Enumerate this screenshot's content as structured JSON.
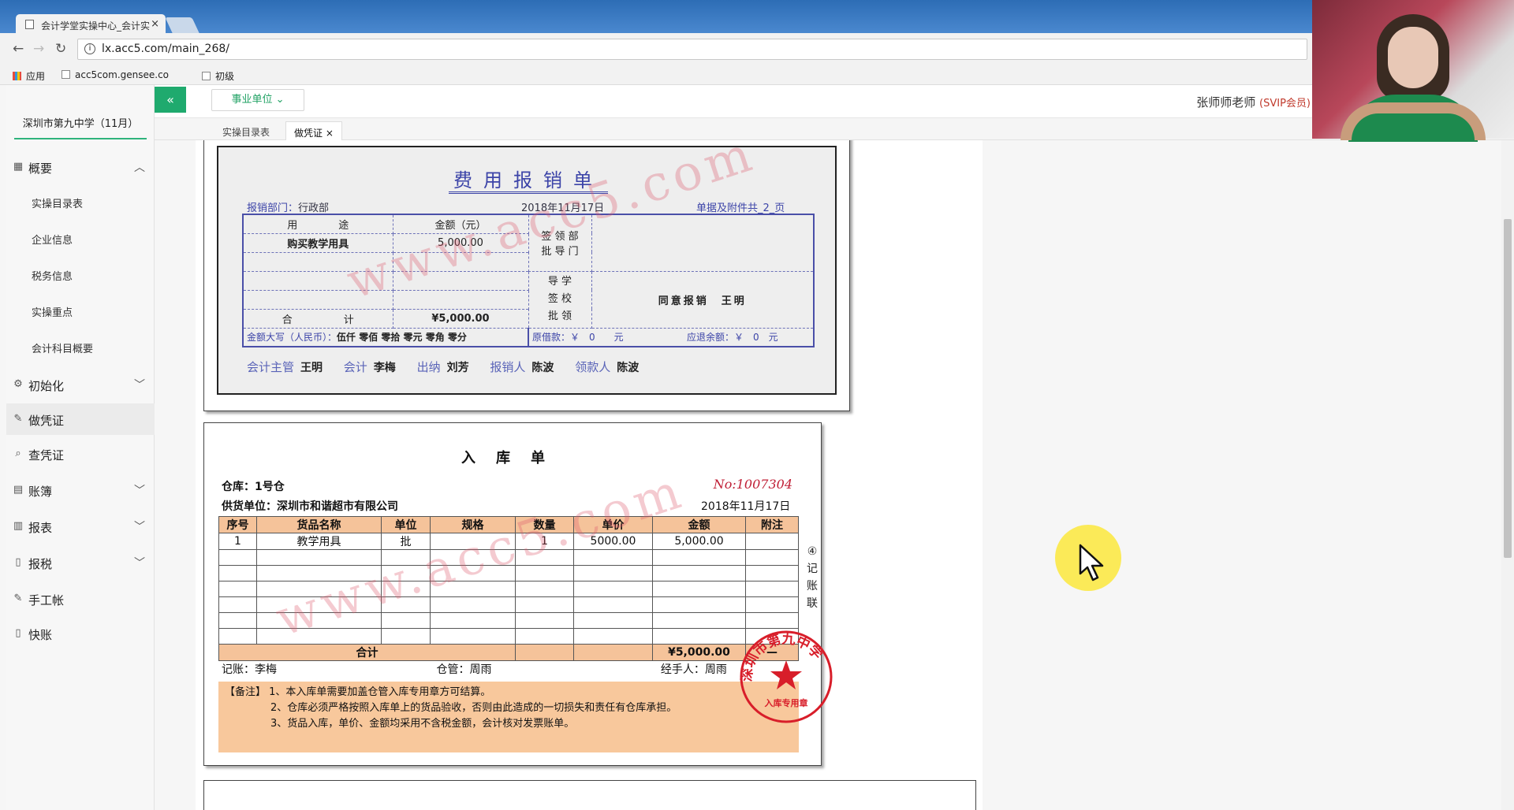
{
  "browser": {
    "tab_title": "会计学堂实操中心_会计实",
    "close": "×",
    "url": "lx.acc5.com/main_268/",
    "bookmarks": [
      "应用",
      "acc5com.gensee.co",
      "初级"
    ]
  },
  "sidebar": {
    "company": "深圳市第九中学（11月）",
    "sections": [
      {
        "label": "概要",
        "icon": "grid-icon",
        "expanded": true
      },
      {
        "label": "初始化",
        "icon": "gear-icon"
      },
      {
        "label": "做凭证",
        "icon": "pencil-icon",
        "active": true
      },
      {
        "label": "查凭证",
        "icon": "search-icon"
      },
      {
        "label": "账簿",
        "icon": "book-icon"
      },
      {
        "label": "报表",
        "icon": "report-icon"
      },
      {
        "label": "报税",
        "icon": "document-icon"
      },
      {
        "label": "手工帐",
        "icon": "pencil-icon"
      },
      {
        "label": "快账",
        "icon": "document-icon"
      }
    ],
    "sub_items": [
      "实操目录表",
      "企业信息",
      "税务信息",
      "实操重点",
      "会计科目概要"
    ]
  },
  "topbar": {
    "toggle": "«",
    "unit_select": "事业单位",
    "teacher": "张师师老师",
    "membership": "(SVIP会员)"
  },
  "page_tabs": [
    {
      "label": "实操目录表"
    },
    {
      "label": "做凭证",
      "close": "×",
      "active": true
    }
  ],
  "expense_form": {
    "title": "费用报销单",
    "dept_label": "报销部门：",
    "dept": "行政部",
    "date": "2018年11月17日",
    "attachments": "单据及附件共_2_页",
    "col_purpose": "用　　　　途",
    "col_amount": "金额（元）",
    "dept_sign": [
      "签 领 部",
      "批 导 门"
    ],
    "school_sign": [
      "导 学",
      "签 校",
      "批 领"
    ],
    "approve_text": "同意报销　王明",
    "item": "购买教学用具",
    "item_amount": "5,000.00",
    "total_label": "合　　　　　计",
    "total": "¥5,000.00",
    "capital_label": "金额大写（人民币）：",
    "capital": "伍仟 零佰 零拾 零元 零角 零分",
    "loan": "原借款：￥　0　　元",
    "refund": "应退余额：￥　0　元",
    "signatures": [
      {
        "role": "会计主管",
        "name": "王明"
      },
      {
        "role": "会计",
        "name": "李梅"
      },
      {
        "role": "出纳",
        "name": "刘芳"
      },
      {
        "role": "报销人",
        "name": "陈波"
      },
      {
        "role": "领款人",
        "name": "陈波"
      }
    ]
  },
  "receipt_form": {
    "title": "入库单",
    "warehouse": "仓库：1号仓",
    "supplier": "供货单位：深圳市和谐超市有限公司",
    "number": "No:1007304",
    "date": "2018年11月17日",
    "headers": [
      "序号",
      "货品名称",
      "单位",
      "规格",
      "数量",
      "单价",
      "金额",
      "附注"
    ],
    "rows": [
      [
        "1",
        "教学用具",
        "批",
        "",
        "1",
        "5000.00",
        "5,000.00",
        ""
      ]
    ],
    "empty_rows": 6,
    "total_label": "合计",
    "total_amount": "¥5,000.00",
    "total_note": "—",
    "side_label": [
      "④",
      "记",
      "账",
      "联"
    ],
    "bookkeeper": "记账：李梅",
    "keeper": "仓管：周雨",
    "handler": "经手人：周雨",
    "notes": [
      "【备注】 1、本入库单需要加盖仓管入库专用章方可结算。",
      "2、仓库必须严格按照入库单上的货品验收，否则由此造成的一切损失和责任有仓库承担。",
      "3、货品入库，单价、金额均采用不含税金额，会计核对发票账单。"
    ]
  },
  "watermark": "www.acc5.com",
  "stamp": {
    "name": "深圳市第九中学",
    "label": "入库专用章"
  },
  "colors": {
    "accent": "#1faa6e",
    "stamp": "#d81e2a",
    "note_bg": "#f8c89c",
    "form_blue": "#3c44a8"
  }
}
